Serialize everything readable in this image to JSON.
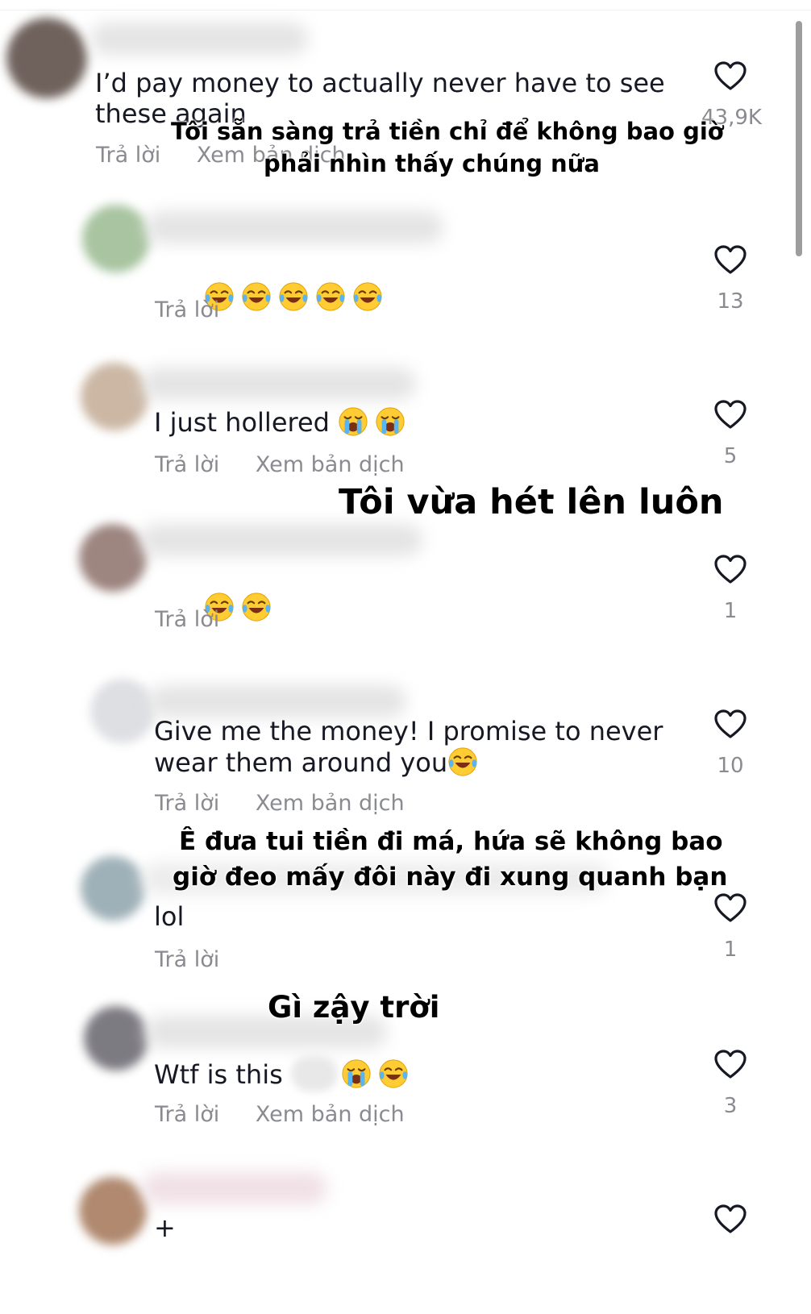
{
  "comments": [
    {
      "text": "I’d pay money to actually never have to see these again",
      "emojis": [],
      "actions": [
        "Trả lời",
        "Xem bản dịch"
      ],
      "likes": "43,9K",
      "avatar_color": "#6f625c"
    },
    {
      "text": "",
      "emojis": [
        "joy-emoji",
        "joy-emoji",
        "joy-emoji",
        "joy-emoji",
        "joy-emoji"
      ],
      "actions": [
        "Trả lời"
      ],
      "likes": "13",
      "avatar_color": "#a8c4a0"
    },
    {
      "text": "I just hollered ",
      "emojis": [
        "sob-emoji",
        "sob-emoji"
      ],
      "actions": [
        "Trả lời",
        "Xem bản dịch"
      ],
      "likes": "5",
      "avatar_color": "#cbb7a4"
    },
    {
      "text": "",
      "emojis": [
        "joy-emoji",
        "joy-emoji"
      ],
      "actions": [
        "Trả lời"
      ],
      "likes": "1",
      "avatar_color": "#9d8580"
    },
    {
      "text": "Give me the money! I promise to never wear them around you",
      "emojis": [
        "joy-emoji"
      ],
      "actions": [
        "Trả lời",
        "Xem bản dịch"
      ],
      "likes": "10",
      "avatar_color": "#dedfe3"
    },
    {
      "text": "lol",
      "emojis": [],
      "actions": [
        "Trả lời"
      ],
      "likes": "1",
      "avatar_color": "#9fb1b8"
    },
    {
      "text": "Wtf is this ",
      "emojis": [
        "sob-emoji",
        "joy-emoji"
      ],
      "actions": [
        "Trả lời",
        "Xem bản dịch"
      ],
      "likes": "3",
      "avatar_color": "#7d7b82"
    },
    {
      "text": "+",
      "emojis": [],
      "actions": [],
      "likes": "",
      "avatar_color": "#b0896f"
    }
  ],
  "overlays": {
    "translation_1_line1": "Tôi sẵn sàng trả tiền chỉ để không bao giờ",
    "translation_1_line2": "phải nhìn thấy chúng nữa",
    "translation_2": "Tôi vừa hét lên luôn",
    "translation_3_line1": "Ê đưa tui tiền đi má, hứa sẽ không bao",
    "translation_3_line2": "giờ đeo mấy đôi này đi xung quanh bạn",
    "translation_4": "Gì zậy trời"
  },
  "colors": {
    "text": "#161823",
    "secondary": "#8a8b91",
    "heart": "#161823",
    "background": "#ffffff"
  }
}
